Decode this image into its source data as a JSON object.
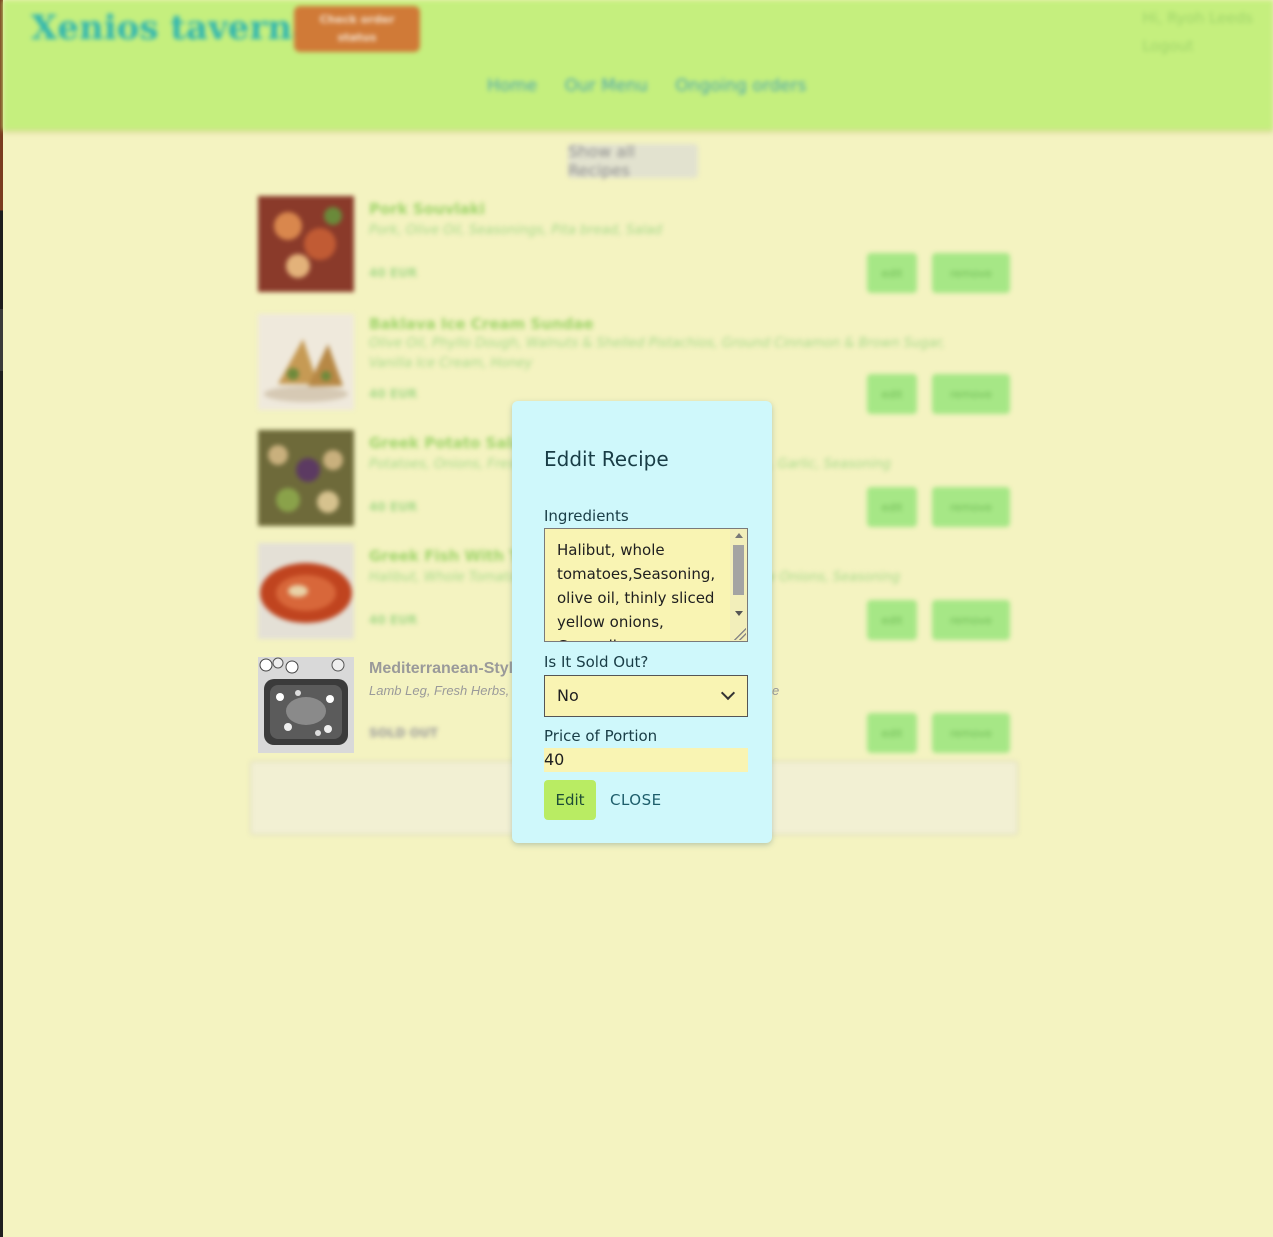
{
  "header": {
    "brand": "Xenios taverna",
    "check_orders_label": "Check order status",
    "greeting": "Hi, Ryoh Leeds",
    "logout_label": "Logout",
    "nav": [
      "Home",
      "Our Menu",
      "Ongoing orders"
    ]
  },
  "show_all_label": "Show all Recipes",
  "recipes": [
    {
      "title": "Pork Souvlaki",
      "ingredients": "Pork, Olive Oil, Seasonings, Pita bread, Salad",
      "price": "40 EUR",
      "edit": "edit",
      "remove": "remove"
    },
    {
      "title": "Baklava Ice Cream Sundae",
      "ingredients": "Olive Oil, Phyllo Dough, Walnuts & Shelled Pistachios, Ground Cinnamon & Brown Sugar, Vanilla Ice Cream, Honey",
      "price": "40 EUR",
      "edit": "edit",
      "remove": "remove"
    },
    {
      "title": "Greek Potato Salad",
      "ingredients": "Potatoes, Onions, Fresh Herbs, Olive Oil, Lemon Juice, Capers, Garlic, Seasoning",
      "price": "40 EUR",
      "edit": "edit",
      "remove": "remove"
    },
    {
      "title": "Greek Fish With Tomatoes",
      "ingredients": "Halibut, Whole Tomatoes, Olive Oil, Garlic, Thinly Sliced Yellow Onions, Seasoning",
      "price": "40 EUR",
      "edit": "edit",
      "remove": "remove"
    },
    {
      "title": "Mediterranean-Style",
      "ingredients": "Lamb Leg, Fresh Herbs,",
      "ingredients_tail": "e",
      "price": "SOLD OUT",
      "edit": "edit",
      "remove": "remove"
    }
  ],
  "modal": {
    "title": "Eddit Recipe",
    "ingredients_label": "Ingredients",
    "ingredients_value": "Halibut, whole tomatoes,Seasoning, olive oil, thinly sliced yellow onions, Garnarlic",
    "sold_out_label": "Is It Sold Out?",
    "sold_out_value": "No",
    "price_label": "Price of Portion",
    "price_value": "40",
    "edit_label": "Edit",
    "close_label": "CLOSE"
  },
  "colors": {
    "background": "#f4f3c1",
    "header": "#c5ef7e",
    "modal": "#cff8fb",
    "field": "#f9f4b3",
    "edit_button": "#b9ec63",
    "check_button": "#d07a37"
  }
}
